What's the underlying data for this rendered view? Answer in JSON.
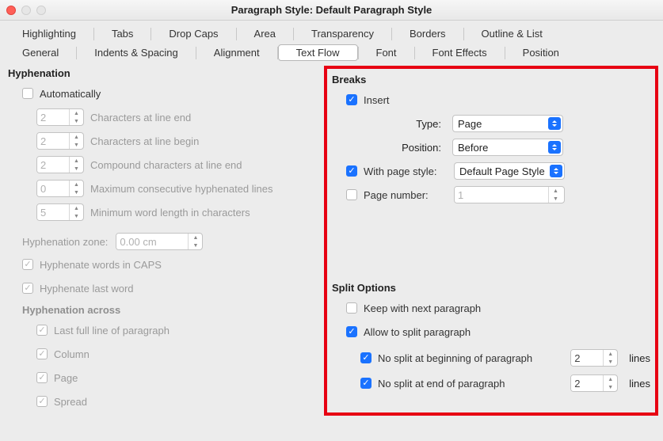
{
  "window": {
    "title": "Paragraph Style: Default Paragraph Style"
  },
  "tabs_top": {
    "t0": "Highlighting",
    "t1": "Tabs",
    "t2": "Drop Caps",
    "t3": "Area",
    "t4": "Transparency",
    "t5": "Borders",
    "t6": "Outline & List"
  },
  "tabs_bottom": {
    "t0": "General",
    "t1": "Indents & Spacing",
    "t2": "Alignment",
    "t3": "Text Flow",
    "t4": "Font",
    "t5": "Font Effects",
    "t6": "Position"
  },
  "hyph": {
    "title": "Hyphenation",
    "auto": "Automatically",
    "end_val": "2",
    "end_lbl": "Characters at line end",
    "begin_val": "2",
    "begin_lbl": "Characters at line begin",
    "compound_val": "2",
    "compound_lbl": "Compound characters at line end",
    "max_val": "0",
    "max_lbl": "Maximum consecutive hyphenated lines",
    "minword_val": "5",
    "minword_lbl": "Minimum word length in characters",
    "zone_lbl": "Hyphenation zone:",
    "zone_val": "0.00 cm",
    "caps": "Hyphenate words in CAPS",
    "last": "Hyphenate last word",
    "across_title": "Hyphenation across",
    "across_line": "Last full line of paragraph",
    "across_col": "Column",
    "across_page": "Page",
    "across_spread": "Spread"
  },
  "breaks": {
    "title": "Breaks",
    "insert": "Insert",
    "type_lbl": "Type:",
    "type_val": "Page",
    "pos_lbl": "Position:",
    "pos_val": "Before",
    "withps": "With page style:",
    "withps_val": "Default Page Style",
    "pagenum_lbl": "Page number:",
    "pagenum_val": "1"
  },
  "split": {
    "title": "Split Options",
    "keep": "Keep with next paragraph",
    "allow": "Allow to split paragraph",
    "nosplit_begin": "No split at beginning of paragraph",
    "nosplit_end": "No split at end of paragraph",
    "begin_val": "2",
    "end_val": "2",
    "lines": "lines"
  }
}
